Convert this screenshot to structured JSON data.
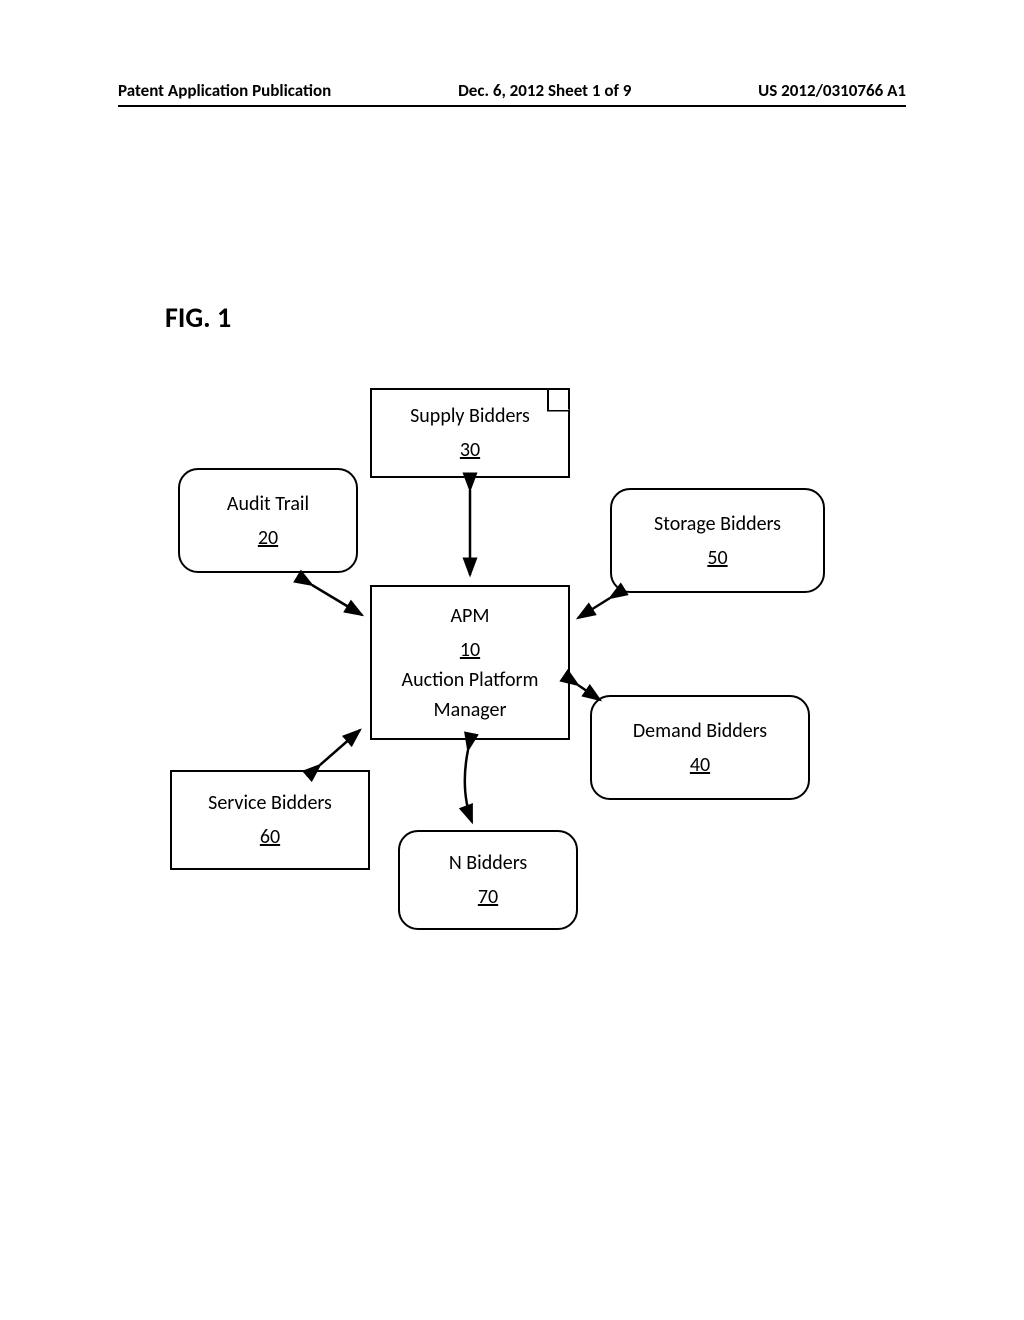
{
  "header": {
    "left": "Patent Application Publication",
    "center": "Dec. 6, 2012  Sheet 1 of 9",
    "right": "US 2012/0310766 A1"
  },
  "figure_label": "FIG. 1",
  "boxes": {
    "apm": {
      "line1": "APM",
      "refnum": "10",
      "line2_a": "Auction Platform",
      "line2_b": "Manager"
    },
    "audit": {
      "line1": "Audit Trail",
      "refnum": "20"
    },
    "supply": {
      "line1": "Supply Bidders",
      "refnum": "30"
    },
    "storage": {
      "line1": "Storage Bidders",
      "refnum": "50"
    },
    "demand": {
      "line1": "Demand Bidders",
      "refnum": "40"
    },
    "service": {
      "line1": "Service Bidders",
      "refnum": "60"
    },
    "nbidders": {
      "line1": "N Bidders",
      "refnum": "70"
    }
  }
}
